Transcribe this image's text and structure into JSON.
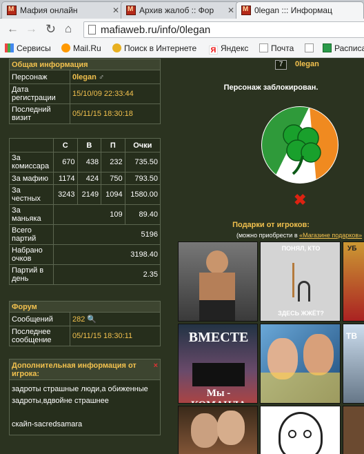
{
  "browser": {
    "tabs": [
      {
        "title": "Мафия онлайн"
      },
      {
        "title": "Архив жалоб :: Фор"
      },
      {
        "title": "0legan ::: Информац"
      }
    ],
    "url": "mafiaweb.ru/info/0legan",
    "bookmarks": [
      "Сервисы",
      "Mail.Ru",
      "Поиск в Интернете",
      "Яндекс",
      "Почта",
      "",
      "Расписа"
    ]
  },
  "general": {
    "header": "Общая информация",
    "rows": [
      {
        "label": "Персонаж",
        "value": "0legan"
      },
      {
        "label": "Дата регистрации",
        "value": "15/10/09 22:33:44"
      },
      {
        "label": "Последний визит",
        "value": "05/11/15 18:30:18"
      }
    ]
  },
  "stats": {
    "columns": [
      "С",
      "В",
      "П",
      "Очки"
    ],
    "rows": [
      {
        "label": "За комиссара",
        "s": "670",
        "v": "438",
        "p": "232",
        "score": "735.50"
      },
      {
        "label": "За мафию",
        "s": "1174",
        "v": "424",
        "p": "750",
        "score": "793.50"
      },
      {
        "label": "За честных",
        "s": "3243",
        "v": "2149",
        "p": "1094",
        "score": "1580.00"
      },
      {
        "label": "За маньяка",
        "p": "109",
        "score": "89.40"
      }
    ],
    "totals": [
      {
        "label": "Всего партий",
        "value": "5196"
      },
      {
        "label": "Набрано очков",
        "value": "3198.40"
      },
      {
        "label": "Партий в день",
        "value": "2.35"
      }
    ]
  },
  "forum": {
    "header": "Форум",
    "rows": [
      {
        "label": "Сообщений",
        "value": "282"
      },
      {
        "label": "Последнее сообщение",
        "value": "05/11/15 18:30:11"
      }
    ]
  },
  "extra": {
    "header": "Дополнительная информация от игрока:",
    "close": "×",
    "line1": "задроты страшные люди,а обиженные задроты,вдвойне страшнее",
    "line2": "скайп-sacredsamara"
  },
  "profile": {
    "level": "7",
    "name": "0legan",
    "blocked": "Персонаж заблокирован.",
    "gifts_title": "Подарки от игроков:",
    "gifts_note_prefix": "(можно приобрести в",
    "gifts_link": "«Магазине подарков»"
  },
  "gifts": [
    {
      "caption": ""
    },
    {
      "caption": "ПОНЯЛ, КТО",
      "caption2": "ЗДЕСЬ ЖЖЁТ?"
    },
    {
      "caption": "УБ"
    },
    {
      "caption": "ВМЕСТЕ",
      "caption2": "Мы - КОМАНДА"
    },
    {
      "caption": ""
    },
    {
      "caption": "ТВ"
    },
    {
      "caption": ""
    },
    {
      "caption": ""
    }
  ],
  "colors": {
    "page_bg": "#2b3320",
    "accent": "#f2c14e",
    "border": "#5c6650"
  }
}
